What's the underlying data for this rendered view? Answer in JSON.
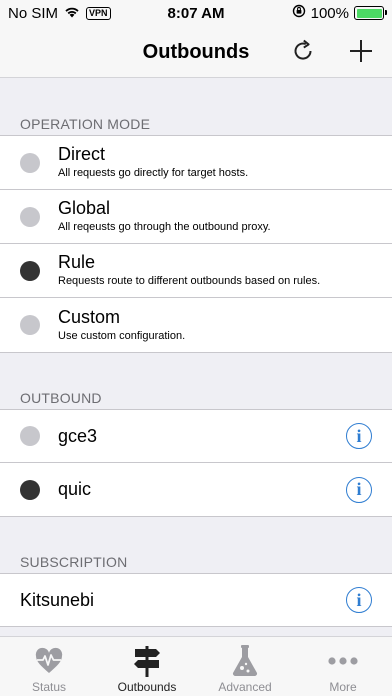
{
  "status_bar": {
    "carrier": "No SIM",
    "vpn": "VPN",
    "time": "8:07 AM",
    "battery": "100%"
  },
  "nav": {
    "title": "Outbounds",
    "refresh_icon": "refresh-icon",
    "add_icon": "plus-icon"
  },
  "sections": {
    "operation_mode": {
      "header": "OPERATION MODE",
      "items": [
        {
          "title": "Direct",
          "subtitle": "All requests go directly for target hosts.",
          "selected": false
        },
        {
          "title": "Global",
          "subtitle": "All reqeusts go through the outbound proxy.",
          "selected": false
        },
        {
          "title": "Rule",
          "subtitle": "Requests route to different outbounds based on rules.",
          "selected": true
        },
        {
          "title": "Custom",
          "subtitle": "Use custom configuration.",
          "selected": false
        }
      ]
    },
    "outbound": {
      "header": "OUTBOUND",
      "items": [
        {
          "title": "gce3",
          "selected": false
        },
        {
          "title": "quic",
          "selected": true
        }
      ]
    },
    "subscription": {
      "header": "SUBSCRIPTION",
      "items": [
        {
          "title": "Kitsunebi"
        }
      ]
    }
  },
  "info_glyph": "i",
  "tabs": [
    {
      "label": "Status",
      "icon": "heart-pulse-icon",
      "active": false
    },
    {
      "label": "Outbounds",
      "icon": "signpost-icon",
      "active": true
    },
    {
      "label": "Advanced",
      "icon": "flask-icon",
      "active": false
    },
    {
      "label": "More",
      "icon": "more-dots-icon",
      "active": false
    }
  ],
  "colors": {
    "accent": "#2f7dd1",
    "radio_off": "#c7c7cc",
    "radio_on": "#333333",
    "battery": "#4cd964"
  }
}
